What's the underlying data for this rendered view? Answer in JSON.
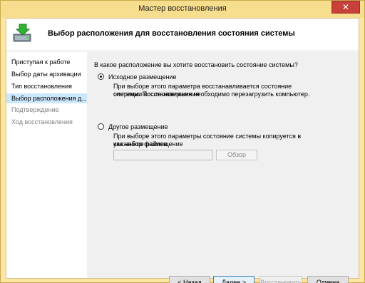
{
  "window": {
    "title": "Мастер восстановления",
    "close_glyph": "✕"
  },
  "header": {
    "title": "Выбор расположения для восстановления состояния системы",
    "icon": "backup-restore-icon"
  },
  "sidebar": {
    "items": [
      {
        "label": "Приступая к работе",
        "state": "normal"
      },
      {
        "label": "Выбор даты архивации",
        "state": "normal"
      },
      {
        "label": "Тип восстановления",
        "state": "normal"
      },
      {
        "label": "Выбор расположения д...",
        "state": "active"
      },
      {
        "label": "Подтверждение",
        "state": "disabled"
      },
      {
        "label": "Ход восстановления",
        "state": "disabled"
      }
    ]
  },
  "main": {
    "question": "В какое расположение вы хотите восстановить состояние системы?",
    "option_original": {
      "label": "Исходное размещение",
      "selected": true,
      "description_line1": "При выборе этого параметра восстанавливается состояние системы. После завершения",
      "description_line2": "операции восстановления необходимо перезагрузить компьютер."
    },
    "option_other": {
      "label": "Другое размещение",
      "selected": false,
      "description_line1": "При выборе этого параметры состояние системы копируется в указанное размещение",
      "description_line2": "как набор файлов.",
      "path_value": "",
      "browse_label": "Обзор"
    }
  },
  "footer": {
    "back_label": "< Назад",
    "next_label": "Далее >",
    "restore_label": "Восстановить",
    "cancel_label": "Отмена"
  }
}
